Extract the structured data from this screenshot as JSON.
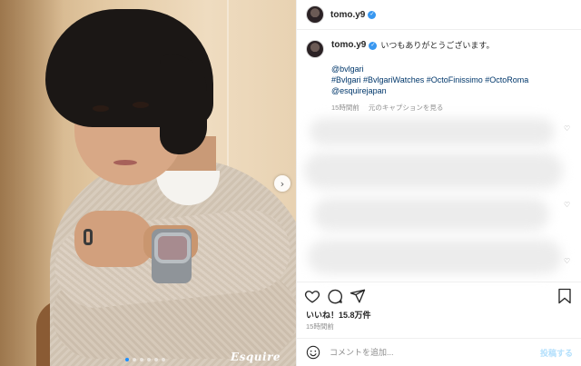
{
  "post": {
    "author": "tomo.y9",
    "caption_text": "いつもありがとうございます。",
    "tags": [
      "@bvlgari",
      "#Bvlgari #BvlgariWatches #OctoFinissimo #OctoRoma",
      "@esquirejapan"
    ],
    "caption_time": "15時間前",
    "see_translation": "元のキャプションを見る",
    "likes": "いいね！15.8万件",
    "time": "15時間前",
    "photo_brand": "Esquire",
    "carousel": {
      "count": 6,
      "active_index": 0
    }
  },
  "comment_bar": {
    "placeholder": "コメントを追加...",
    "post_label": "投稿する"
  },
  "colors": {
    "link": "#00376b",
    "verified": "#3897f0",
    "muted": "#8e8e8e",
    "post_button": "#b2dffc"
  }
}
